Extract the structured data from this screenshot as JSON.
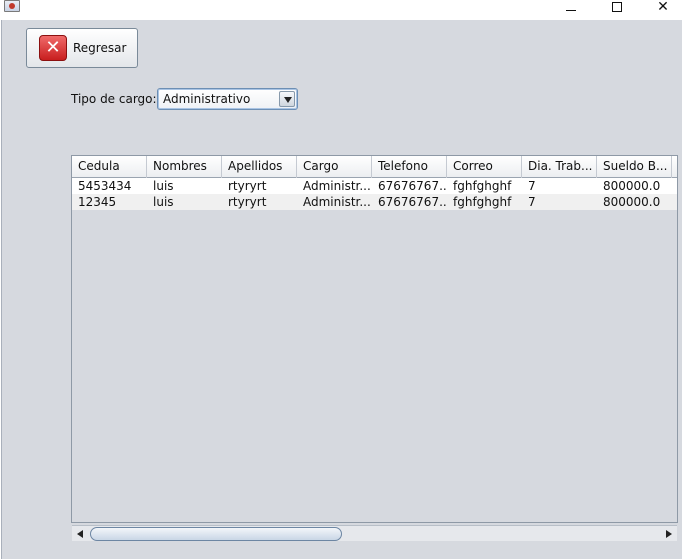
{
  "window": {
    "minimize": "—",
    "close": "✕"
  },
  "toolbar": {
    "back_label": "Regresar",
    "back_icon": "close-x-icon",
    "back_icon_color": "#d32f2f"
  },
  "filter": {
    "label": "Tipo de cargo:",
    "selected": "Administrativo"
  },
  "table": {
    "columns": [
      "Cedula",
      "Nombres",
      "Apellidos",
      "Cargo",
      "Telefono",
      "Correo",
      "Dia. Trab...",
      "Sueldo B..."
    ],
    "rows": [
      [
        "5453434",
        "luis",
        "rtyryrt",
        "Administr...",
        "67676767...",
        "fghfghghf",
        "7",
        "800000.0"
      ],
      [
        "12345",
        "luis",
        "rtyryrt",
        "Administr...",
        "67676767...",
        "fghfghghf",
        "7",
        "800000.0"
      ]
    ]
  }
}
